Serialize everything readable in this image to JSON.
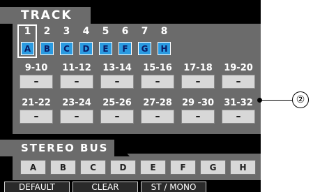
{
  "track_section": {
    "title": "TRACK",
    "track_numbers": [
      "1",
      "2",
      "3",
      "4",
      "5",
      "6",
      "7",
      "8"
    ],
    "track_letters": [
      "A",
      "B",
      "C",
      "D",
      "E",
      "F",
      "G",
      "H"
    ],
    "selected_track": "1"
  },
  "pair_rows": [
    {
      "labels": [
        "9-10",
        "11-12",
        "13-14",
        "15-16",
        "17-18",
        "19-20"
      ],
      "values": [
        "–",
        "–",
        "–",
        "–",
        "–",
        "–"
      ]
    },
    {
      "labels": [
        "21-22",
        "23-24",
        "25-26",
        "27-28",
        "29 -30",
        "31-32"
      ],
      "values": [
        "–",
        "–",
        "–",
        "–",
        "–",
        "–"
      ]
    }
  ],
  "stereo_bus": {
    "title": "STEREO BUS",
    "buttons": [
      "A",
      "B",
      "C",
      "D",
      "E",
      "F",
      "G",
      "H"
    ]
  },
  "function_keys": [
    "DEFAULT",
    "CLEAR",
    "ST / MONO"
  ],
  "callout": {
    "number": "②"
  },
  "colors": {
    "track_button": "#2a9ae0",
    "track_letter": "#0a1a66",
    "panel": "#6b6b6b",
    "button": "#d8d8d8"
  }
}
